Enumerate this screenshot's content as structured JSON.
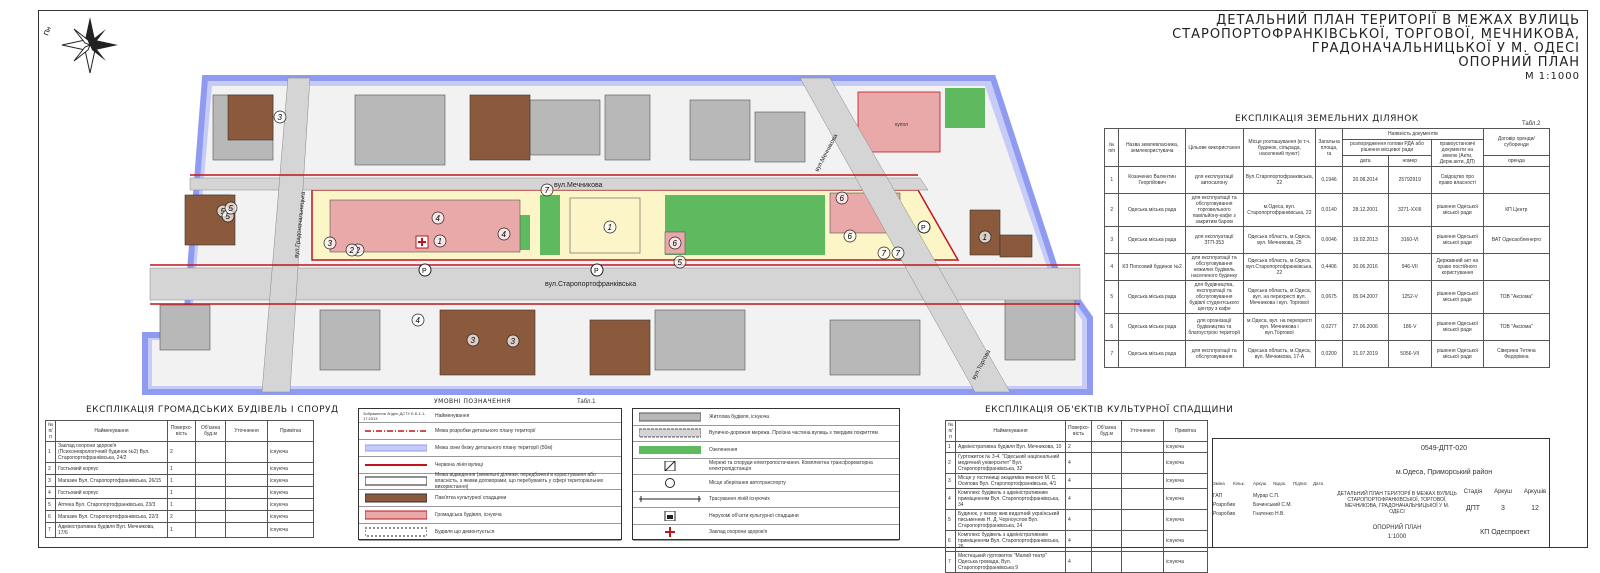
{
  "title": {
    "lines": [
      "ДЕТАЛЬНИЙ ПЛАН ТЕРИТОРІЇ В МЕЖАХ ВУЛИЦЬ",
      "СТАРОПОРТОФРАНКІВСЬКОЇ, ТОРГОВОЇ, МЕЧНИКОВА,",
      "ГРАДОНАЧАЛЬНИЦЬКОЇ У М. ОДЕСІ",
      "ОПОРНИЙ ПЛАН"
    ],
    "scale": "М 1:1000"
  },
  "compass": {
    "north": "Пн",
    "icon": "compass-rose-icon"
  },
  "streets": {
    "mechnykova": "вул.Мечникова",
    "staroportofrankivska": "вул.Старопортофранківська",
    "hradonachalnytska": "вул.Градоначальницька",
    "torhova": "вул.Торгова",
    "mechnykova_diag": "вул.Мечникова"
  },
  "map_labels": {
    "kupol": "купол"
  },
  "map_markers": [
    "1",
    "2",
    "3",
    "4",
    "5",
    "6",
    "7",
    "4",
    "5",
    "6",
    "7",
    "7",
    "3",
    "5",
    "2",
    "1",
    "4",
    "3",
    "5",
    "6",
    "1",
    "3"
  ],
  "land": {
    "caption": "ЕКСПЛІКАЦІЯ ЗЕМЕЛЬНИХ ДІЛЯНОК",
    "tab": "Табл.2",
    "headers": {
      "n": "№ п/п",
      "user": "Назва землевласника, землекористувача",
      "purpose": "Цільове використання",
      "location": "Місце розташування (в т.ч. будинок, сільрада, населений пункт)",
      "area": "Загальна площа, га",
      "docs": "Наявність документів",
      "decision": "розпорядження голови РДА або рішення місцевої ради",
      "date": "дата",
      "number": "номер",
      "rights": "правоустановчі документи на землю (Акти, Держ.акти, ДП)",
      "lease": "Договір оренди/суборенди",
      "lease_sub": "оренда"
    },
    "rows": [
      {
        "n": "1",
        "user": "Козаченко Валентин Георгійович",
        "purpose": "для експлуатації автосалону",
        "location": "Вул.Старопортофранківська, 22",
        "area": "0,1946",
        "date": "20.08.2014",
        "number": "25792919",
        "rights": "Свідоцтво про право власності",
        "lease": ""
      },
      {
        "n": "2",
        "user": "Одеська міська рада",
        "purpose": "для експлуатації та обслуговування торговельного павільйону-кафе з закритим баром",
        "location": "м.Одеса, вул. Старопортофранківська, 22",
        "area": "0,0140",
        "date": "28.12.2001",
        "number": "3271-XXIII",
        "rights": "рішення Одеської міської ради",
        "lease": "КП Центр"
      },
      {
        "n": "3",
        "user": "Одеська міська рада",
        "purpose": "для експлуатації ЗТП-353",
        "location": "Одеська область, м.Одеса, вул. Мечникова, 25",
        "area": "0,0046",
        "date": "19.02.2013",
        "number": "3160-VI",
        "rights": "рішення Одеської міської ради",
        "lease": "ВАТ Одесаобленерго"
      },
      {
        "n": "4",
        "user": "КЗ Попсовий будинок №2",
        "purpose": "для експлуатації та обслуговування нежилих будівель населеного будинку",
        "location": "Одеська область, м.Одеса, вул.Старопортофранківська, 22",
        "area": "0,4406",
        "date": "30.06.2016",
        "number": "946-VII",
        "rights": "Державний акт на право постійного користування",
        "lease": ""
      },
      {
        "n": "5",
        "user": "Одеська міська рада",
        "purpose": "для будівництва, експлуатації та обслуговування будівлі студентського центру з кафе",
        "location": "Одеська область, м.Одеса, вул. на перехресті вул. Мечникова і вул. Торгової",
        "area": "0,0675",
        "date": "05.04.2007",
        "number": "1252-V",
        "rights": "рішення Одеської міської ради",
        "lease": "ТОВ \"Аксіома\""
      },
      {
        "n": "6",
        "user": "Одеська міська рада",
        "purpose": "для організації будівництва та благоустрою території",
        "location": "м.Одеса, вул. на перехресті вул. Мечникова і вул.Торгової",
        "area": "0,0277",
        "date": "27.06.2006",
        "number": "186-V",
        "rights": "рішення Одеської міської ради",
        "lease": "ТОВ \"Аксіома\""
      },
      {
        "n": "7",
        "user": "Одеська міська рада",
        "purpose": "для експлуатації та обслуговування",
        "location": "Одеська область, м.Одеса, вул. Мечникова, 17-А",
        "area": "0,0200",
        "date": "31.07.2019",
        "number": "5056-VII",
        "rights": "рішення Одеської міської ради",
        "lease": "Сіверина Тетяна Федорівна"
      }
    ]
  },
  "public": {
    "caption": "ЕКСПЛІКАЦІЯ ГРОМАДСЬКИХ БУДІВЕЛЬ І СПОРУД",
    "headers": [
      "№ п/п",
      "Найменування",
      "Поверхо-вість",
      "Об'ємна буд.м",
      "Уточнення",
      "Примітка"
    ],
    "rows": [
      [
        "1",
        "Заклад охорони здоров'я (Психоневрологічний будинок №2) Вул. Старопортофранківська, 24/2",
        "2",
        "",
        "",
        "існуюча"
      ],
      [
        "2",
        "Гостьовий корпус",
        "1",
        "",
        "",
        "існуюча"
      ],
      [
        "3",
        "Магазин Вул. Старопортофранківська, 26/15",
        "1",
        "",
        "",
        "існуюча"
      ],
      [
        "4",
        "Гостьовий корпус",
        "1",
        "",
        "",
        "існуюча"
      ],
      [
        "5",
        "Аптека Вул. Старопортофранківська, 23/3",
        "1",
        "",
        "",
        "існуюча"
      ],
      [
        "6",
        "Магазин Вул. Старопортофранківська, 22/3",
        "2",
        "",
        "",
        "існуюча"
      ],
      [
        "7",
        "Адміністративна будівля Вул. Мечникова, 17/6",
        "1",
        "",
        "",
        "існуюча"
      ]
    ]
  },
  "legend1": {
    "caption": "УМОВНІ ПОЗНАЧЕННЯ",
    "tab": "Табл.1",
    "header_sym": "Зображення Згідно ДСТУ Б Б.1.1-17:2013",
    "header_name": "Найменування",
    "items": [
      "Межа розробки детального плану території",
      "Межа зони бюжу детального плану території (50м)",
      "Червона лінія вулиці",
      "Межа відведення (земельні ділянки, передбачені в користування або власність, з якими договорами, що перебувають у сфері територіальних використання)",
      "Пам'ятка культурної спадщини",
      "Громадська будівля, існуюча",
      "Будівля що демонтується"
    ]
  },
  "legend2": {
    "items": [
      "Житлова будівля, існуюча",
      "Вулично-дорожня мережа. Проїзна частина вулиць з твердим покриттям",
      "Озеленення",
      "Мережі та споруди електропостачання. Комплектна трансформаторна електропідстанція",
      "Місце зберігання автотранспорту",
      "Трасування ліній існуючих",
      "Нерухомі об'єкти культурної спадщини",
      "Заклад охорони здоров'я"
    ]
  },
  "heritage": {
    "caption": "ЕКСПЛІКАЦІЯ ОБ'ЄКТІВ КУЛЬТУРНОЇ СПАДЩИНИ",
    "headers": [
      "№ п/п",
      "Найменування",
      "Поверхо-вість",
      "Об'ємна буд.м",
      "Уточнення",
      "Примітка"
    ],
    "rows": [
      [
        "1",
        "Адміністративна будівля Вул. Мечникова, 10",
        "2",
        "",
        "",
        "існуюча"
      ],
      [
        "2",
        "Гуртожиток № 3-4. \"Одеський національний медичний університет\" Вул. Старопортофранківська, 32",
        "4",
        "",
        "",
        "існуюча"
      ],
      [
        "3",
        "Місце у гостинищі академіка вченого М. С. Осипова Вул. Старопортофранківська, 4/1",
        "4",
        "",
        "",
        "існуюча"
      ],
      [
        "4",
        "Комплекс будівель з адміністративним приміщенням Вул. Старопортофранківська, 34",
        "4",
        "",
        "",
        "існуюча"
      ],
      [
        "5",
        "Будинок, у якому жив видатний український письменник Н. Д. Чорноуслов Вул. Старопортофранківська, 24",
        "4",
        "",
        "",
        "існуюча"
      ],
      [
        "6",
        "Комплекс будівель з адміністративним приміщенням Вул. Старопортофранківська, 26",
        "4",
        "",
        "",
        "існуюча"
      ],
      [
        "7",
        "Мистецький гуртожиток \"Малий театр\" Одеська громада, Вул. Старопортофранківська 9",
        "4",
        "",
        "",
        "існуюча"
      ]
    ]
  },
  "stamp": {
    "code": "0549-ДПТ-020",
    "place": "м.Одеса, Приморський район",
    "project": "ДЕТАЛЬНИЙ ПЛАН ТЕРИТОРІЇ В МЕЖАХ ВУЛИЦЬ СТАРОПОРТОФРАНКІВСЬКОЇ, ТОРГОВОЇ, МЕЧНИКОВА, ГРАДОНАЧАЛЬНИЦЬКОЇ У М. ОДЕСІ",
    "sheet_name": "ОПОРНИЙ ПЛАН",
    "sheet_scale": "1:1000",
    "org": "КП Одеспроект",
    "stage_h": "Стадія",
    "stage": "ДПТ",
    "sheet_h": "Аркуш",
    "sheet": "3",
    "sheets_h": "Аркушів",
    "sheets": "12",
    "cols": [
      "Зміна",
      "Кільк.",
      "Аркуш",
      "№док.",
      "Підпис",
      "Дата"
    ],
    "roles": [
      {
        "role": "ГАП",
        "name": "Мурар С.П."
      },
      {
        "role": "Розробив",
        "name": "Бачинський С.М."
      },
      {
        "role": "Розробив",
        "name": "Гнатенко Н.В."
      }
    ]
  },
  "colors": {
    "plan_boundary": "#8f9bf0",
    "red_line": "#c0151e",
    "heritage": "#8b5a3c",
    "public": "#e9a9a9",
    "residential": "#b8b8b8",
    "green": "#5fb95f",
    "road": "#d5d5d5",
    "yellow_zone": "#fbf5c8"
  }
}
